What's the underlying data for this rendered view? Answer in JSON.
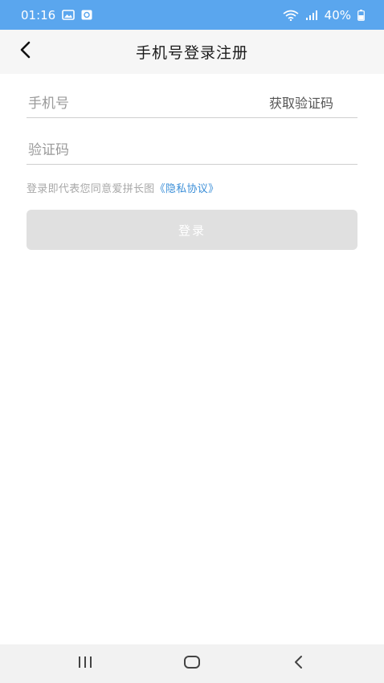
{
  "status_bar": {
    "time": "01:16",
    "battery": "40%",
    "icons": [
      "gallery-icon",
      "notification-icon",
      "wifi-icon",
      "signal-icon",
      "battery-icon"
    ]
  },
  "header": {
    "title": "手机号登录注册",
    "back_icon": "chevron-left-icon"
  },
  "form": {
    "phone_placeholder": "手机号",
    "get_code_label": "获取验证码",
    "code_placeholder": "验证码"
  },
  "agreement": {
    "text": "登录即代表您同意爱拼长图",
    "link_text": "《隐私协议》"
  },
  "login_button": {
    "label": "登录"
  },
  "nav_bar": {
    "icons": [
      "recent-apps-icon",
      "home-icon",
      "back-icon"
    ]
  },
  "colors": {
    "status_bar": "#5aa6ee",
    "header_bg": "#f6f6f6",
    "link": "#3c8fd8",
    "disabled_button": "#e0e0e0"
  }
}
